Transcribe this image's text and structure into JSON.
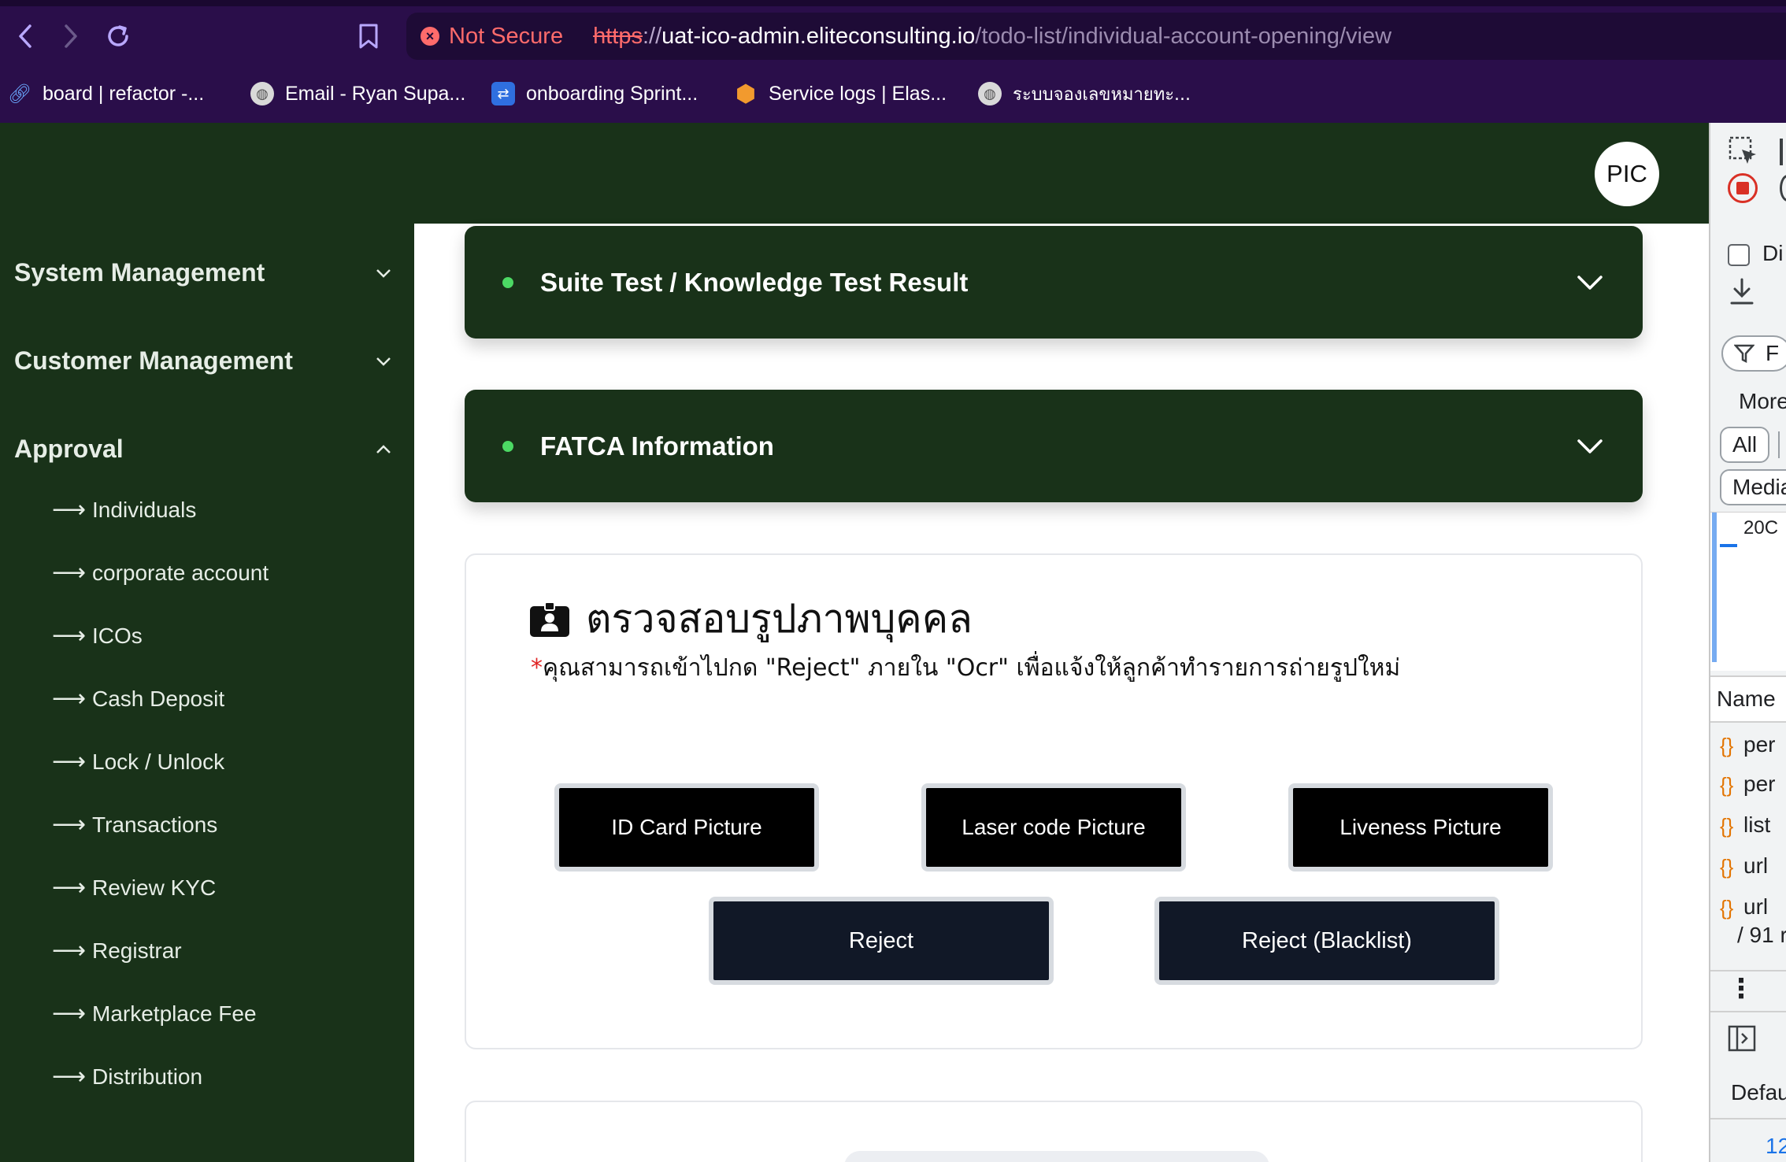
{
  "browser": {
    "not_secure_label": "Not Secure",
    "url": {
      "scheme": "https",
      "separator": "://",
      "host": "uat-ico-admin.eliteconsulting.io",
      "path": "/todo-list/individual-account-opening/view"
    },
    "bookmarks": [
      {
        "label": "board | refactor -...",
        "icon": "link-icon"
      },
      {
        "label": "Email - Ryan Supa...",
        "icon": "globe-icon"
      },
      {
        "label": "onboarding Sprint...",
        "icon": "jira-icon"
      },
      {
        "label": "Service logs | Elas...",
        "icon": "hexagon-icon"
      },
      {
        "label": "ระบบจองเลขหมายทะ...",
        "icon": "globe-icon"
      }
    ]
  },
  "header": {
    "avatar_label": "PIC"
  },
  "sidebar": {
    "sections": [
      {
        "label": "System Management",
        "expanded": false
      },
      {
        "label": "Customer Management",
        "expanded": false
      },
      {
        "label": "Approval",
        "expanded": true
      }
    ],
    "approval_items": [
      "Individuals",
      "corporate account",
      "ICOs",
      "Cash Deposit",
      "Lock / Unlock",
      "Transactions",
      "Review KYC",
      "Registrar",
      "Marketplace Fee",
      "Distribution"
    ],
    "arrow_glyph": "⟶"
  },
  "main": {
    "accordions": [
      {
        "title": "Suite Test / Knowledge Test Result"
      },
      {
        "title": "FATCA Information"
      }
    ],
    "photo_card": {
      "heading": "ตรวจสอบรูปภาพบุคคล",
      "required_mark": "*",
      "note": "คุณสามารถเข้าไปกด \"Reject\" ภายใน \"Ocr\" เพื่อแจ้งให้ลูกค้าทำรายการถ่ายรูปใหม่",
      "picture_buttons": [
        "ID Card Picture",
        "Laser code Picture",
        "Liveness Picture"
      ],
      "reject_label": "Reject",
      "reject_blacklist_label": "Reject (Blacklist)"
    }
  },
  "devtools": {
    "checkbox_label": "Di",
    "filter_label": "F",
    "more_label": "More",
    "all_label": "All",
    "media_label": "Media",
    "timeline_value": "20C",
    "name_header": "Name",
    "requests": [
      "per",
      "per",
      "list",
      "url",
      "url"
    ],
    "count_text": "/ 91 r",
    "default_label": "Defau",
    "bottom_value": "12"
  },
  "colors": {
    "browser_bg": "#2a0e4a",
    "app_green": "#193219",
    "status_dot": "#4cd964",
    "not_secure": "#ff6b6b"
  }
}
